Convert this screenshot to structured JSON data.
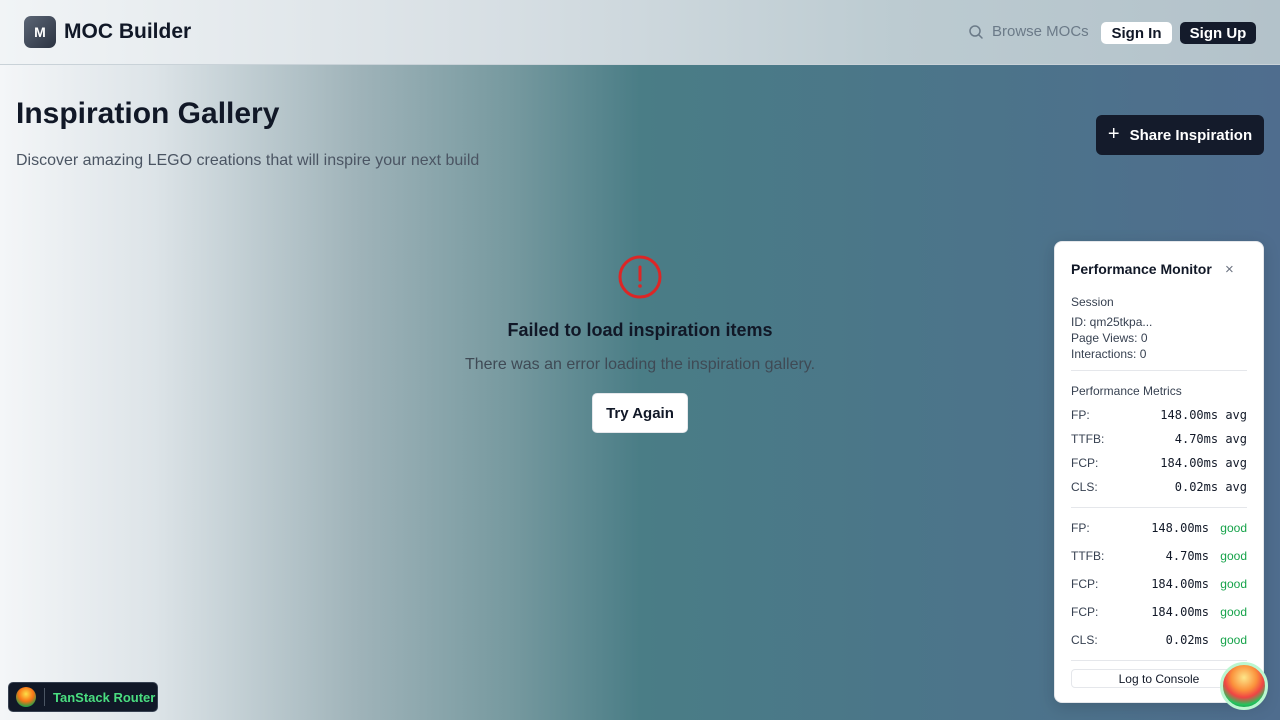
{
  "header": {
    "logo_letter": "M",
    "app_name": "MOC Builder",
    "browse_label": "Browse MOCs",
    "signin_label": "Sign In",
    "signup_label": "Sign Up"
  },
  "page": {
    "title": "Inspiration Gallery",
    "subtitle": "Discover amazing LEGO creations that will inspire your next build",
    "share_label": "Share Inspiration"
  },
  "error": {
    "title": "Failed to load inspiration items",
    "description": "There was an error loading the inspiration gallery.",
    "retry_label": "Try Again"
  },
  "perf_monitor": {
    "title": "Performance Monitor",
    "close_glyph": "×",
    "session_label": "Session",
    "session_id": "ID: qm25tkpa...",
    "page_views": "Page Views: 0",
    "interactions": "Interactions: 0",
    "metrics_label": "Performance Metrics",
    "averages": [
      {
        "name": "FP:",
        "value": "148.00ms avg"
      },
      {
        "name": "TTFB:",
        "value": "4.70ms avg"
      },
      {
        "name": "FCP:",
        "value": "184.00ms avg"
      },
      {
        "name": "CLS:",
        "value": "0.02ms avg"
      }
    ],
    "vitals": [
      {
        "name": "FP:",
        "value": "148.00ms",
        "status": "good"
      },
      {
        "name": "TTFB:",
        "value": "4.70ms",
        "status": "good"
      },
      {
        "name": "FCP:",
        "value": "184.00ms",
        "status": "good"
      },
      {
        "name": "FCP:",
        "value": "184.00ms",
        "status": "good"
      },
      {
        "name": "CLS:",
        "value": "0.02ms",
        "status": "good"
      }
    ],
    "log_label": "Log to Console"
  },
  "devtools": {
    "badge_label": "TanStack Router"
  },
  "colors": {
    "primary": "#141b2b",
    "error": "#dc2626",
    "good": "#16a34a"
  }
}
